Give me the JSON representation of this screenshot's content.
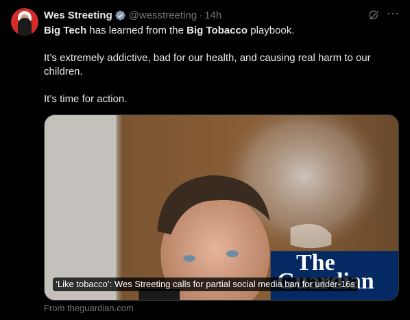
{
  "author": {
    "display_name": "Wes Streeting",
    "handle": "@wesstreeting",
    "separator": "·",
    "time": "14h",
    "verified_icon": "verified-badge-icon",
    "avatar_icon": "avatar"
  },
  "tweet": {
    "line1_bold1": "Big Tech",
    "line1_mid": " has learned from the ",
    "line1_bold2": "Big Tobacco",
    "line1_end": " playbook.",
    "line2": "It’s extremely addictive, bad for our health, and causing real harm to our children.",
    "line3": "It’s time for action."
  },
  "card": {
    "caption": "‘Like tobacco’: Wes Streeting calls for partial social media ban for under-16s",
    "logo_line1": "The",
    "logo_line2": "Guardian",
    "source": "From theguardian.com"
  },
  "colors": {
    "background": "#000000",
    "text": "#e7e9ea",
    "muted": "#71767b",
    "guardian_blue": "#052962",
    "verified": "#829aab"
  },
  "icons": {
    "grok": "grok-icon",
    "more": "more-icon"
  }
}
